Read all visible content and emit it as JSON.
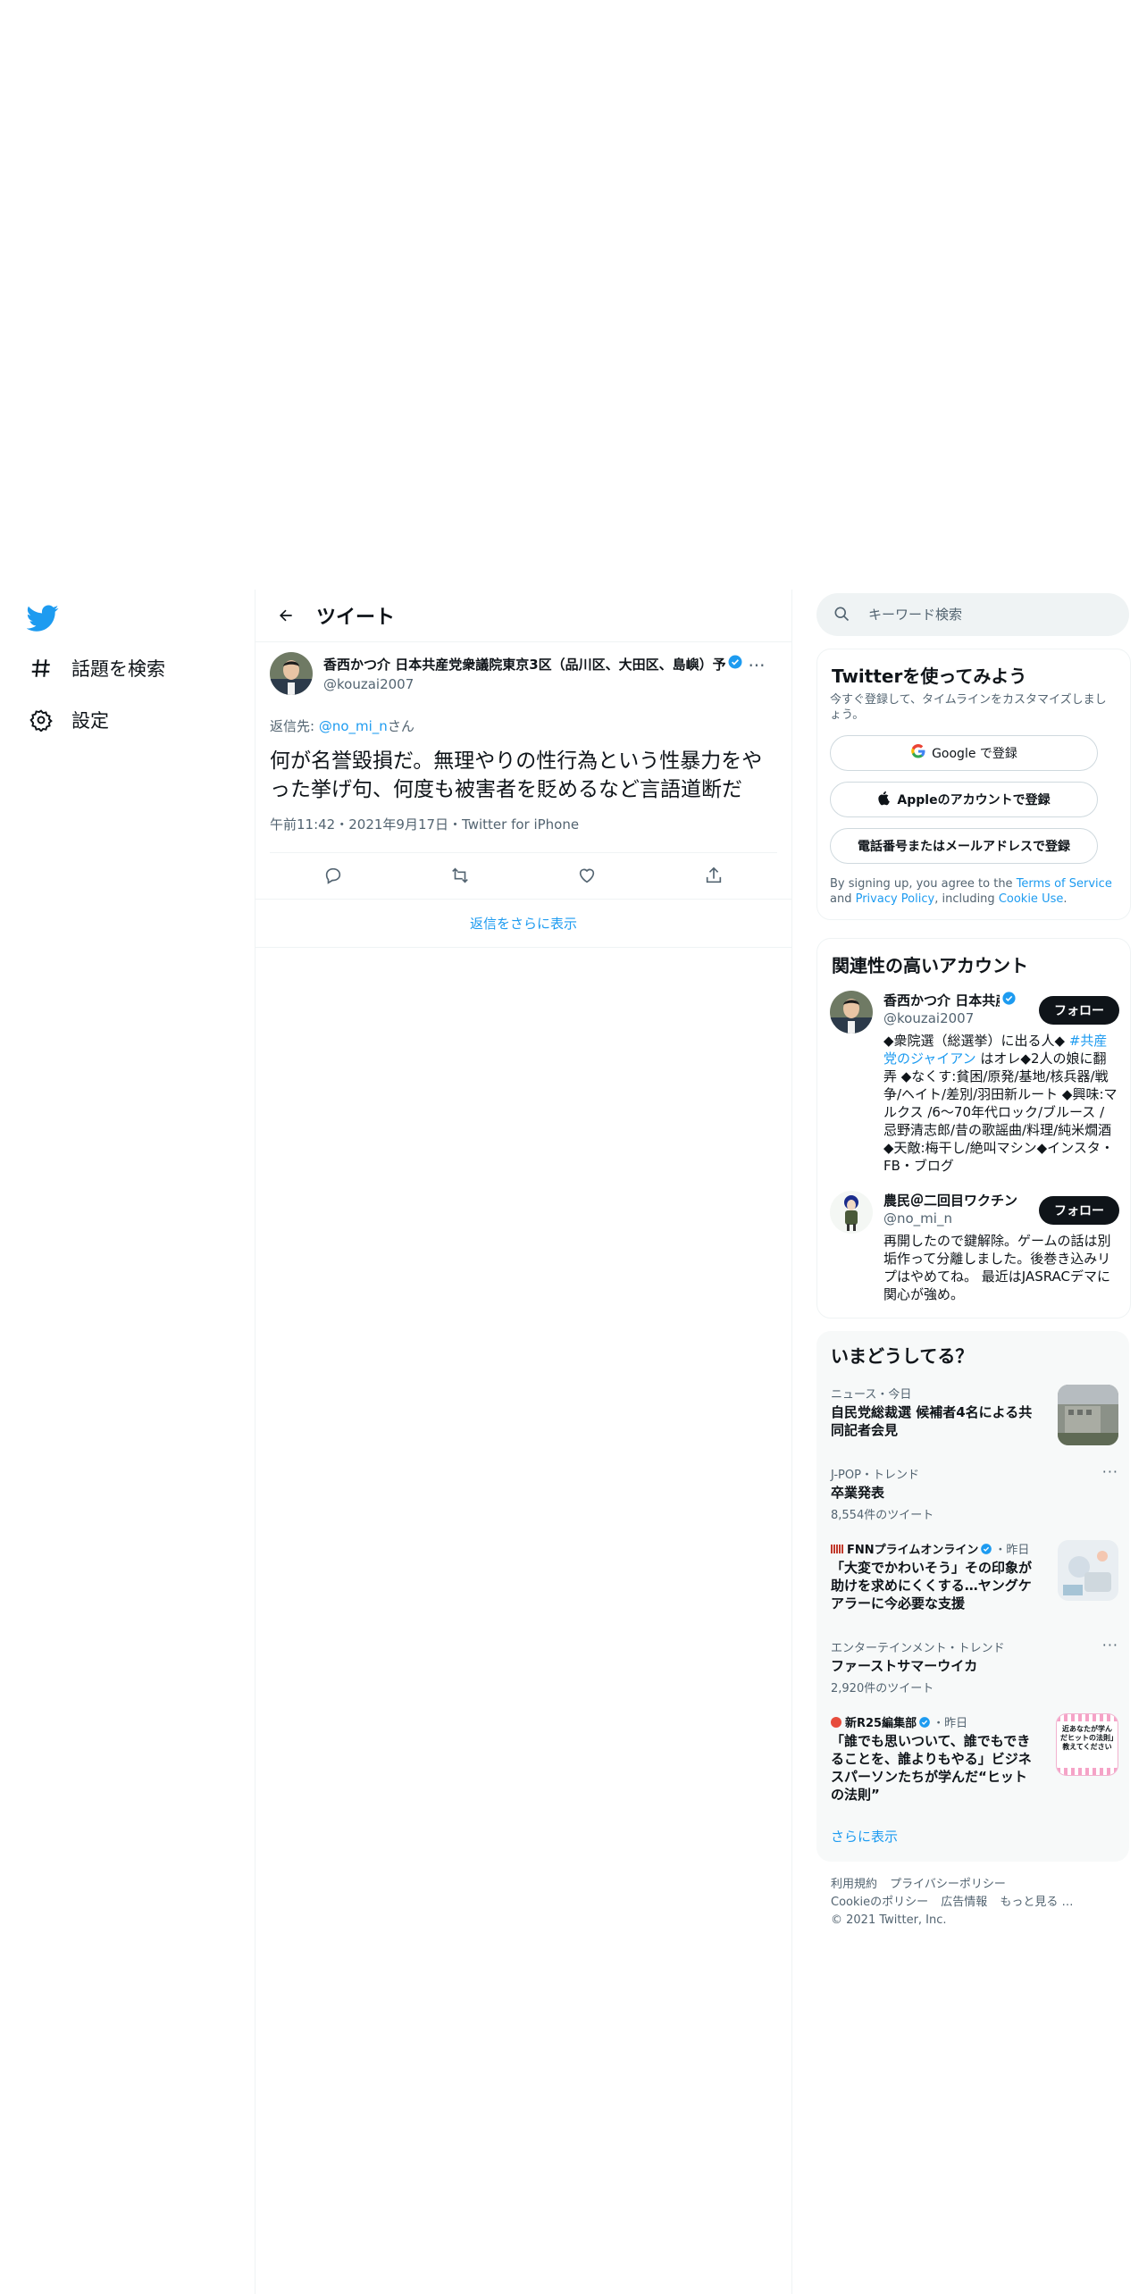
{
  "nav": {
    "logo": "twitter-bird-icon",
    "items": [
      {
        "label": "話題を検索",
        "icon": "hashtag-icon"
      },
      {
        "label": "設定",
        "icon": "gear-icon"
      }
    ]
  },
  "center": {
    "header_title": "ツイート",
    "tweet": {
      "author_name": "香西かつ介 日本共産党衆議院東京3区（品川区、大田区、島嶼）予",
      "author_handle": "@kouzai2007",
      "reply_prefix": "返信先: ",
      "reply_to": "@no_mi_n",
      "reply_suffix": "さん",
      "text": "何が名誉毀損だ。無理やりの性行為という性暴力をやった挙げ句、何度も被害者を貶めるなど言語道断だ",
      "meta": "午前11:42・2021年9月17日・Twitter for iPhone"
    },
    "show_replies": "返信をさらに表示"
  },
  "sidebar": {
    "search_placeholder": "キーワード検索",
    "signup": {
      "title": "Twitterを使ってみよう",
      "subtitle": "今すぐ登録して、タイムラインをカスタマイズしましょう。",
      "google_label": "Google で登録",
      "apple_label": "Appleのアカウントで登録",
      "phone_label": "電話番号またはメールアドレスで登録",
      "legal_prefix": "By signing up, you agree to the ",
      "legal_tos": "Terms of Service",
      "legal_and": " and ",
      "legal_privacy": "Privacy Policy",
      "legal_including": ", including ",
      "legal_cookie": "Cookie Use",
      "legal_end": "."
    },
    "related": {
      "title": "関連性の高いアカウント",
      "follow_label": "フォロー",
      "accounts": [
        {
          "name": "香西かつ介 日本共産",
          "handle": "@kouzai2007",
          "bio_before": "◆衆院選（総選挙）に出る人◆ ",
          "bio_link": "#共産党のジャイアン",
          "bio_after": " はオレ◆2人の娘に翻弄 ◆なくす:貧困/原発/基地/核兵器/戦争/ヘイト/差別/羽田新ルート ◆興味:マルクス /6～70年代ロック/ブルース / 忌野清志郎/昔の歌謡曲/料理/純米燗酒 ◆天敵:梅干し/絶叫マシン◆インスタ・FB・ブログ"
        },
        {
          "name": "農民＠二回目ワクチン済",
          "handle": "@no_mi_n",
          "bio": "再開したので鍵解除。ゲームの話は別垢作って分離しました。後巻き込みリプはやめてね。 最近はJASRACデマに関心が強め。"
        }
      ]
    },
    "trends": {
      "title": "いまどうしてる？",
      "items": [
        {
          "context": "ニュース・今日",
          "title": "自民党総裁選 候補者4名による共同記者会見"
        },
        {
          "context": "J-POP・トレンド",
          "title": "卒業発表",
          "count": "8,554件のツイート"
        },
        {
          "source": "FNNプライムオンライン",
          "time": "・昨日",
          "title": "「大変でかわいそう」その印象が助けを求めにくくする…ヤングケアラーに今必要な支援"
        },
        {
          "context": "エンターテインメント・トレンド",
          "title": "ファーストサマーウイカ",
          "count": "2,920件のツイート"
        },
        {
          "source": "新R25編集部",
          "time": "・昨日",
          "title": "「誰でも思いついて、誰でもできることを、誰よりもやる」ビジネスパーソンたちが学んだ“ヒットの法則”",
          "thumb_text": "近あなたが学んだヒットの法則」教えてください"
        }
      ],
      "show_more": "さらに表示"
    },
    "footer": {
      "links_row1": [
        "利用規約",
        "プライバシーポリシー"
      ],
      "links_row2": [
        "Cookieのポリシー",
        "広告情報",
        "もっと見る …"
      ],
      "copyright": "© 2021 Twitter, Inc."
    }
  },
  "colors": {
    "accent": "#1d9bf0",
    "text": "#0f1419",
    "muted": "#536471"
  }
}
